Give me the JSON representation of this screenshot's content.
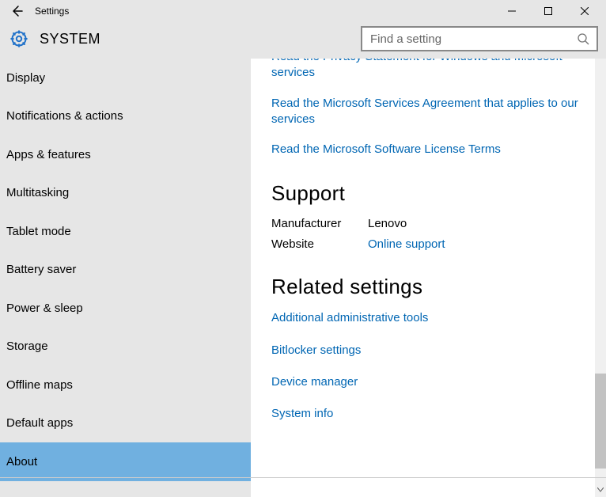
{
  "window": {
    "title": "Settings"
  },
  "header": {
    "section_title": "SYSTEM",
    "search_placeholder": "Find a setting"
  },
  "sidebar": {
    "items": [
      {
        "label": "Display",
        "selected": false
      },
      {
        "label": "Notifications & actions",
        "selected": false
      },
      {
        "label": "Apps & features",
        "selected": false
      },
      {
        "label": "Multitasking",
        "selected": false
      },
      {
        "label": "Tablet mode",
        "selected": false
      },
      {
        "label": "Battery saver",
        "selected": false
      },
      {
        "label": "Power & sleep",
        "selected": false
      },
      {
        "label": "Storage",
        "selected": false
      },
      {
        "label": "Offline maps",
        "selected": false
      },
      {
        "label": "Default apps",
        "selected": false
      },
      {
        "label": "About",
        "selected": true
      }
    ]
  },
  "content": {
    "top_links": [
      "Read the Privacy Statement for Windows and Microsoft services",
      "Read the Microsoft Services Agreement that applies to our services",
      "Read the Microsoft Software License Terms"
    ],
    "support": {
      "heading": "Support",
      "manufacturer_label": "Manufacturer",
      "manufacturer_value": "Lenovo",
      "website_label": "Website",
      "website_link": "Online support"
    },
    "related": {
      "heading": "Related settings",
      "links": [
        "Additional administrative tools",
        "Bitlocker settings",
        "Device manager",
        "System info"
      ]
    }
  }
}
